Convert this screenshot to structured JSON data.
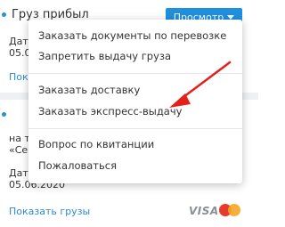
{
  "shipment_top": {
    "status": "Груз прибыл",
    "view_button": "Просмотр",
    "date_label": "Дата",
    "date_value": "05.0",
    "show_link": "Показать"
  },
  "shipment_bottom": {
    "line1": "на те",
    "line2": "«Сев",
    "date_label": "Дата",
    "date_value": "05.06.2020",
    "show_link": "Показать грузы",
    "payment_visa": "VISA"
  },
  "menu": {
    "items": [
      "Заказать документы по перевозке",
      "Запретить выдачу груза",
      "Заказать доставку",
      "Заказать экспресс-выдачу",
      "Вопрос по квитанции",
      "Пожаловаться"
    ]
  },
  "colors": {
    "accent": "#1f8fe0",
    "link": "#2d8ad6",
    "arrow": "#e3201b"
  },
  "icons": {
    "dropdown": "chevron-down-icon",
    "status": "status-dot-icon",
    "mastercard": "mastercard-icon"
  }
}
